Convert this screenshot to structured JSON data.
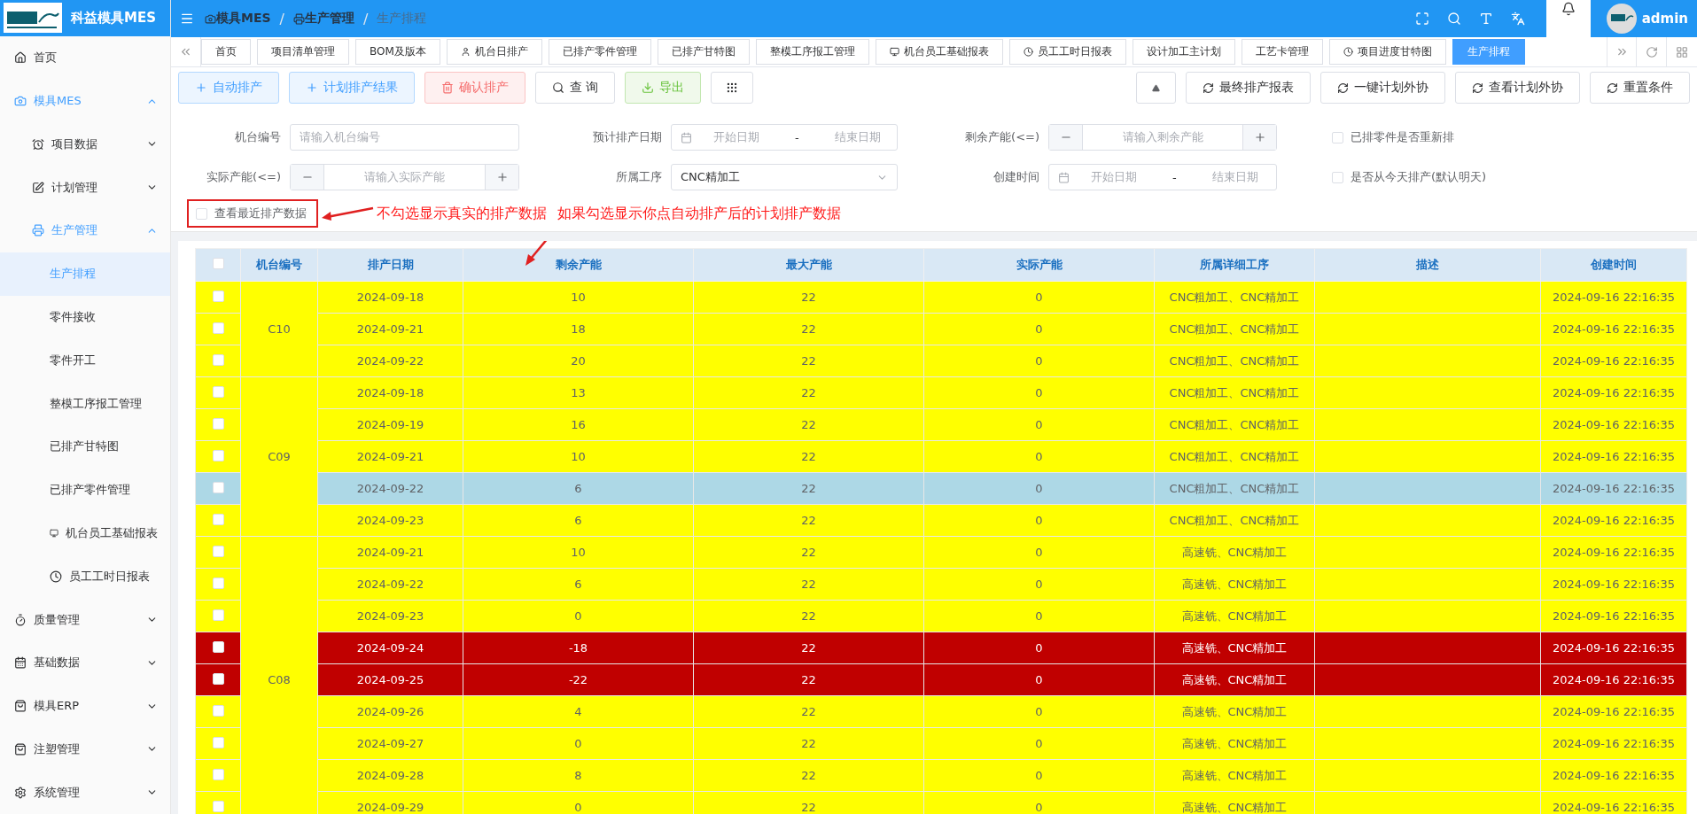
{
  "app": {
    "title": "科益模具MES",
    "user": "admin"
  },
  "breadcrumb": [
    {
      "label": "模具MES"
    },
    {
      "separator": "/",
      "label": "生产管理"
    },
    {
      "separator": "/",
      "label": "生产排程"
    }
  ],
  "sidebar": {
    "items": [
      {
        "label": "首页",
        "selected": false
      },
      {
        "label": "模具MES",
        "expanded": true,
        "children": [
          {
            "label": "项目数据",
            "expanded": false
          },
          {
            "label": "计划管理",
            "expanded": false
          },
          {
            "label": "生产管理",
            "expanded": true,
            "children": [
              {
                "label": "生产排程",
                "selected": true
              },
              {
                "label": "零件接收",
                "selected": false
              },
              {
                "label": "零件开工",
                "selected": false
              },
              {
                "label": "整模工序报工管理",
                "selected": false
              },
              {
                "label": "已排产甘特图",
                "selected": false
              },
              {
                "label": "已排产零件管理",
                "selected": false
              },
              {
                "label": "机台员工基础报表",
                "selected": false
              },
              {
                "label": "员工工时日报表",
                "selected": false
              }
            ]
          }
        ]
      },
      {
        "label": "质量管理",
        "expanded": false
      },
      {
        "label": "基础数据",
        "expanded": false
      },
      {
        "label": "模具ERP",
        "expanded": false
      },
      {
        "label": "注塑管理",
        "expanded": false
      },
      {
        "label": "系统管理",
        "expanded": false
      }
    ]
  },
  "tabs": [
    {
      "label": "首页",
      "selected": false
    },
    {
      "label": "项目清单管理",
      "selected": false
    },
    {
      "label": "BOM及版本",
      "selected": false
    },
    {
      "label": "机台日排产",
      "selected": false
    },
    {
      "label": "已排产零件管理",
      "selected": false
    },
    {
      "label": "已排产甘特图",
      "selected": false
    },
    {
      "label": "整模工序报工管理",
      "selected": false
    },
    {
      "label": "机台员工基础报表",
      "selected": false
    },
    {
      "label": "员工工时日报表",
      "selected": false
    },
    {
      "label": "设计加工主计划",
      "selected": false
    },
    {
      "label": "工艺卡管理",
      "selected": false
    },
    {
      "label": "项目进度甘特图",
      "selected": false
    },
    {
      "label": "生产排程",
      "selected": true
    }
  ],
  "toolbar": {
    "left": [
      {
        "label": "自动排产",
        "kind": "add"
      },
      {
        "label": "计划排产结果",
        "kind": "add"
      },
      {
        "label": "确认排产",
        "kind": "danger"
      },
      {
        "label": "查 询",
        "kind": "search"
      },
      {
        "label": "导出",
        "kind": "export"
      }
    ],
    "right": [
      {
        "label": "最终排产报表"
      },
      {
        "label": "一键计划外协"
      },
      {
        "label": "查看计划外协"
      },
      {
        "label": "重置条件"
      }
    ]
  },
  "filters": {
    "rows": [
      [
        {
          "label": "机台编号",
          "kind": "text",
          "placeholder": "请输入机台编号"
        },
        {
          "label": "预计排产日期",
          "kind": "daterange",
          "start_placeholder": "开始日期",
          "separator": "-",
          "end_placeholder": "结束日期"
        },
        {
          "label": "剩余产能(<=)",
          "kind": "number",
          "placeholder": "请输入剩余产能"
        },
        {
          "label": "已排零件是否重新排",
          "kind": "checkbox",
          "checked": false
        }
      ],
      [
        {
          "label": "实际产能(<=)",
          "kind": "number",
          "placeholder": "请输入实际产能"
        },
        {
          "label": "所属工序",
          "kind": "select",
          "value": "CNC精加工"
        },
        {
          "label": "创建时间",
          "kind": "daterange",
          "start_placeholder": "开始日期",
          "separator": "-",
          "end_placeholder": "结束日期"
        },
        {
          "label": "是否从今天排产(默认明天)",
          "kind": "checkbox",
          "checked": false
        }
      ]
    ],
    "recent": {
      "label": "查看最近排产数据",
      "checked": false
    }
  },
  "annotation": {
    "texts": [
      "不勾选显示真实的排产数据",
      "如果勾选显示你点自动排产后的计划排产数据"
    ]
  },
  "table": {
    "select_all_checked": false,
    "columns": [
      "机台编号",
      "排产日期",
      "剩余产能",
      "最大产能",
      "实际产能",
      "所属详细工序",
      "描述",
      "创建时间"
    ],
    "groups": [
      {
        "machine": "C10",
        "color": "#ffff00",
        "rows": [
          {
            "date": "2024-09-18",
            "remaining": "10",
            "max": "22",
            "actual": "0",
            "process": "CNC粗加工、CNC精加工",
            "created": "2024-09-16 22:16:35",
            "color": "#ffff00",
            "selected": false,
            "checked": false
          },
          {
            "date": "2024-09-21",
            "remaining": "18",
            "max": "22",
            "actual": "0",
            "process": "CNC粗加工、CNC精加工",
            "created": "2024-09-16 22:16:35",
            "color": "#ffff00",
            "selected": false,
            "checked": false
          },
          {
            "date": "2024-09-22",
            "remaining": "20",
            "max": "22",
            "actual": "0",
            "process": "CNC粗加工、CNC精加工",
            "created": "2024-09-16 22:16:35",
            "color": "#ffff00",
            "selected": false,
            "checked": false
          }
        ]
      },
      {
        "machine": "C09",
        "color": "#ffff00",
        "rows": [
          {
            "date": "2024-09-18",
            "remaining": "13",
            "max": "22",
            "actual": "0",
            "process": "CNC粗加工、CNC精加工",
            "created": "2024-09-16 22:16:35",
            "color": "#ffff00",
            "selected": false,
            "checked": false
          },
          {
            "date": "2024-09-19",
            "remaining": "16",
            "max": "22",
            "actual": "0",
            "process": "CNC粗加工、CNC精加工",
            "created": "2024-09-16 22:16:35",
            "color": "#ffff00",
            "selected": false,
            "checked": false
          },
          {
            "date": "2024-09-21",
            "remaining": "10",
            "max": "22",
            "actual": "0",
            "process": "CNC粗加工、CNC精加工",
            "created": "2024-09-16 22:16:35",
            "color": "#ffff00",
            "selected": false,
            "checked": false
          },
          {
            "date": "2024-09-22",
            "remaining": "6",
            "max": "22",
            "actual": "0",
            "process": "CNC粗加工、CNC精加工",
            "created": "2024-09-16 22:16:35",
            "selected": true,
            "checked": false
          },
          {
            "date": "2024-09-23",
            "remaining": "6",
            "max": "22",
            "actual": "0",
            "process": "CNC粗加工、CNC精加工",
            "created": "2024-09-16 22:16:35",
            "color": "#ffff00",
            "selected": false,
            "checked": false
          }
        ]
      },
      {
        "machine": "C08",
        "color": "#ffff00",
        "rows": [
          {
            "date": "2024-09-21",
            "remaining": "10",
            "max": "22",
            "actual": "0",
            "process": "高速铣、CNC精加工",
            "created": "2024-09-16 22:16:35",
            "color": "#ffff00",
            "selected": false,
            "checked": false
          },
          {
            "date": "2024-09-22",
            "remaining": "6",
            "max": "22",
            "actual": "0",
            "process": "高速铣、CNC精加工",
            "created": "2024-09-16 22:16:35",
            "color": "#ffff00",
            "selected": false,
            "checked": false
          },
          {
            "date": "2024-09-23",
            "remaining": "0",
            "max": "22",
            "actual": "0",
            "process": "高速铣、CNC精加工",
            "created": "2024-09-16 22:16:35",
            "color": "#ffff00",
            "selected": false,
            "checked": false
          },
          {
            "date": "2024-09-24",
            "remaining": "-18",
            "max": "22",
            "actual": "0",
            "process": "高速铣、CNC精加工",
            "created": "2024-09-16 22:16:35",
            "color": "#c00000",
            "selected": false,
            "checked": false
          },
          {
            "date": "2024-09-25",
            "remaining": "-22",
            "max": "22",
            "actual": "0",
            "process": "高速铣、CNC精加工",
            "created": "2024-09-16 22:16:35",
            "color": "#c00000",
            "selected": false,
            "checked": false
          },
          {
            "date": "2024-09-26",
            "remaining": "4",
            "max": "22",
            "actual": "0",
            "process": "高速铣、CNC精加工",
            "created": "2024-09-16 22:16:35",
            "color": "#ffff00",
            "selected": false,
            "checked": false
          },
          {
            "date": "2024-09-27",
            "remaining": "0",
            "max": "22",
            "actual": "0",
            "process": "高速铣、CNC精加工",
            "created": "2024-09-16 22:16:35",
            "color": "#ffff00",
            "selected": false,
            "checked": false
          },
          {
            "date": "2024-09-28",
            "remaining": "8",
            "max": "22",
            "actual": "0",
            "process": "高速铣、CNC精加工",
            "created": "2024-09-16 22:16:35",
            "color": "#ffff00",
            "selected": false,
            "checked": false
          },
          {
            "date": "2024-09-29",
            "remaining": "0",
            "max": "22",
            "actual": "0",
            "process": "高速铣、CNC精加工",
            "created": "2024-09-16 22:16:35",
            "color": "#ffff00",
            "selected": false,
            "checked": false
          }
        ]
      }
    ]
  }
}
